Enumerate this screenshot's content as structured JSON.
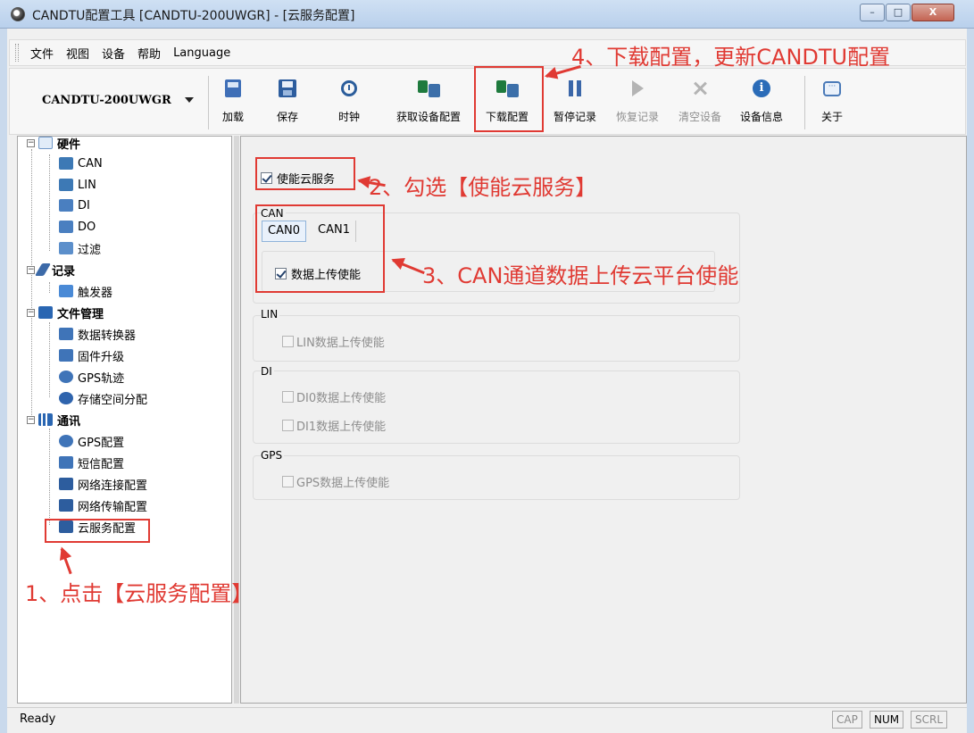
{
  "window": {
    "title": "CANDTU配置工具 [CANDTU-200UWGR] - [云服务配置]",
    "min": "–",
    "max": "□",
    "close": "X"
  },
  "menu": [
    "文件",
    "视图",
    "设备",
    "帮助",
    "Language"
  ],
  "toolbar": {
    "device": "CANDTU-200UWGR",
    "buttons": [
      {
        "label": "加载",
        "icon": "load-icon",
        "enabled": true
      },
      {
        "label": "保存",
        "icon": "save-icon",
        "enabled": true
      },
      {
        "label": "时钟",
        "icon": "clock-icon",
        "enabled": true
      },
      {
        "label": "获取设备配置",
        "icon": "get-config-icon",
        "enabled": true
      },
      {
        "label": "下载配置",
        "icon": "download-config-icon",
        "enabled": true
      },
      {
        "label": "暂停记录",
        "icon": "pause-icon",
        "enabled": true
      },
      {
        "label": "恢复记录",
        "icon": "play-icon",
        "enabled": false
      },
      {
        "label": "清空设备",
        "icon": "clear-icon",
        "enabled": false
      },
      {
        "label": "设备信息",
        "icon": "info-icon",
        "enabled": true
      },
      {
        "label": "关于",
        "icon": "about-icon",
        "enabled": true
      }
    ]
  },
  "tree": {
    "hardware": {
      "label": "硬件",
      "children": [
        "CAN",
        "LIN",
        "DI",
        "DO",
        "过滤"
      ]
    },
    "record": {
      "label": "记录",
      "children": [
        "触发器"
      ]
    },
    "files": {
      "label": "文件管理",
      "children": [
        "数据转换器",
        "固件升级",
        "GPS轨迹",
        "存储空间分配"
      ]
    },
    "comm": {
      "label": "通讯",
      "children": [
        "GPS配置",
        "短信配置",
        "网络连接配置",
        "网络传输配置",
        "云服务配置"
      ]
    },
    "expander": "−"
  },
  "content": {
    "enable_cloud": {
      "label": "使能云服务",
      "checked": true
    },
    "can": {
      "title": "CAN",
      "tabs": [
        "CAN0",
        "CAN1"
      ],
      "upload": {
        "label": "数据上传使能",
        "checked": true
      }
    },
    "lin": {
      "title": "LIN",
      "upload": "LIN数据上传使能"
    },
    "di": {
      "title": "DI",
      "items": [
        "DI0数据上传使能",
        "DI1数据上传使能"
      ]
    },
    "gps": {
      "title": "GPS",
      "upload": "GPS数据上传使能"
    }
  },
  "annotations": {
    "step1": "1、点击【云服务配置】",
    "step2": "2、勾选【使能云服务】",
    "step3": "3、CAN通道数据上传云平台使能",
    "step4": "4、下载配置，更新CANDTU配置",
    "color": "#e03a33"
  },
  "status": {
    "text": "Ready",
    "indicators": [
      "CAP",
      "NUM",
      "SCRL"
    ]
  }
}
